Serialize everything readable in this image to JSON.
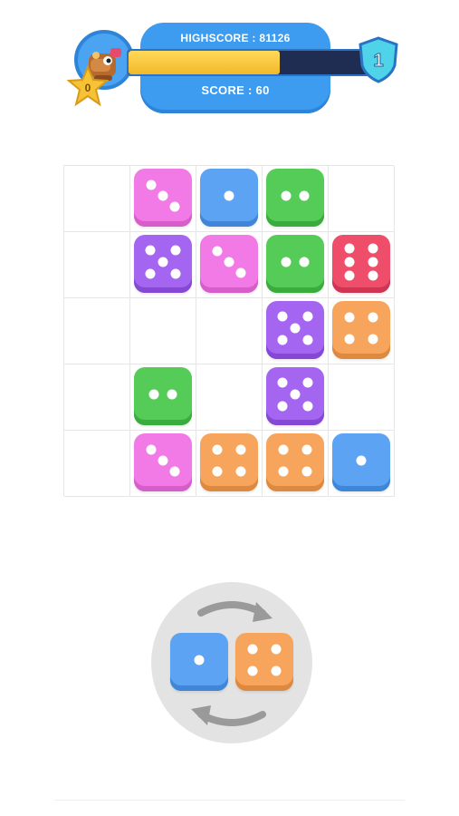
{
  "hud": {
    "highscore_text": "HIGHSCORE : 81126",
    "score_text": "SCORE : 60",
    "level": "1",
    "stars": "0",
    "progress_fraction": 0.62,
    "colors": {
      "panel": "#3d9bf0",
      "progress": "#f3b829",
      "track": "#1f2d52"
    }
  },
  "board": {
    "rows": 5,
    "cols": 5,
    "cells": [
      [
        null,
        {
          "color": "pink",
          "value": 3
        },
        {
          "color": "blue",
          "value": 1
        },
        {
          "color": "green",
          "value": 2
        },
        null
      ],
      [
        null,
        {
          "color": "purple",
          "value": 5
        },
        {
          "color": "pink",
          "value": 3
        },
        {
          "color": "green",
          "value": 2
        },
        {
          "color": "red",
          "value": 6
        }
      ],
      [
        null,
        null,
        null,
        {
          "color": "purple",
          "value": 5
        },
        {
          "color": "orange",
          "value": 4
        }
      ],
      [
        null,
        {
          "color": "green",
          "value": 2
        },
        null,
        {
          "color": "purple",
          "value": 5
        },
        null
      ],
      [
        null,
        {
          "color": "pink",
          "value": 3
        },
        {
          "color": "orange",
          "value": 4
        },
        {
          "color": "orange",
          "value": 4
        },
        {
          "color": "blue",
          "value": 1
        }
      ]
    ]
  },
  "next_piece": [
    {
      "color": "blue",
      "value": 1
    },
    {
      "color": "orange",
      "value": 4
    }
  ],
  "icons": {
    "avatar": "character-avatar-icon",
    "star": "star-icon",
    "level": "shield-icon",
    "rotate": "rotate-arrows-icon"
  }
}
